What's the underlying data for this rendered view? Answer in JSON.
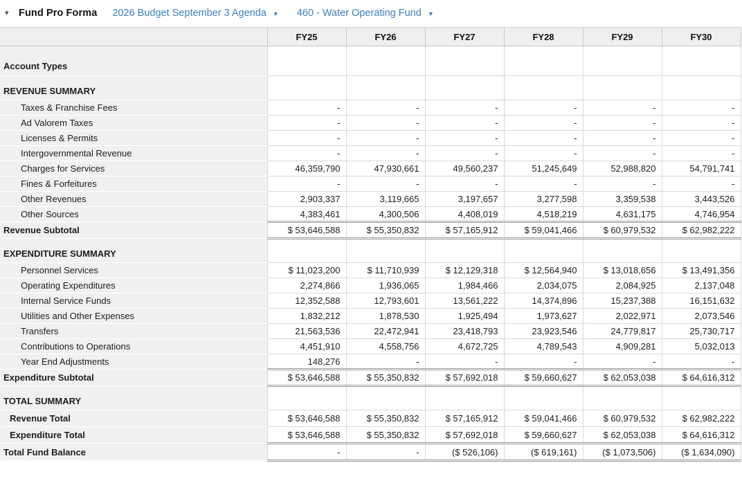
{
  "header": {
    "collapse_icon": "▾",
    "title": "Fund Pro Forma",
    "budget_dropdown": {
      "label": "2026 Budget September 3 Agenda",
      "caret": "▼"
    },
    "fund_dropdown": {
      "label": "460 - Water Operating Fund",
      "caret": "▼"
    }
  },
  "colors": {
    "link_blue": "#3f7fbf",
    "header_gray": "#efefef",
    "label_column_gray": "#f0f0f0",
    "grid_border": "#d9d9d9",
    "double_border": "#999999"
  },
  "table": {
    "columns": [
      "FY25",
      "FY26",
      "FY27",
      "FY28",
      "FY29",
      "FY30"
    ],
    "rows": [
      {
        "type": "account",
        "label": "Account Types",
        "values": [
          "",
          "",
          "",
          "",
          "",
          ""
        ]
      },
      {
        "type": "section",
        "label": "REVENUE SUMMARY",
        "values": [
          "",
          "",
          "",
          "",
          "",
          ""
        ]
      },
      {
        "type": "detail",
        "label": "Taxes & Franchise Fees",
        "values": [
          "-",
          "-",
          "-",
          "-",
          "-",
          "-"
        ]
      },
      {
        "type": "detail",
        "label": "Ad Valorem Taxes",
        "values": [
          "-",
          "-",
          "-",
          "-",
          "-",
          "-"
        ]
      },
      {
        "type": "detail",
        "label": "Licenses & Permits",
        "values": [
          "-",
          "-",
          "-",
          "-",
          "-",
          "-"
        ]
      },
      {
        "type": "detail",
        "label": "Intergovernmental Revenue",
        "values": [
          "-",
          "-",
          "-",
          "-",
          "-",
          "-"
        ]
      },
      {
        "type": "detail",
        "label": "Charges for Services",
        "values": [
          "46,359,790",
          "47,930,661",
          "49,560,237",
          "51,245,649",
          "52,988,820",
          "54,791,741"
        ]
      },
      {
        "type": "detail",
        "label": "Fines & Forfeitures",
        "values": [
          "-",
          "-",
          "-",
          "-",
          "-",
          "-"
        ]
      },
      {
        "type": "detail",
        "label": "Other Revenues",
        "values": [
          "2,903,337",
          "3,119,665",
          "3,197,657",
          "3,277,598",
          "3,359,538",
          "3,443,526"
        ]
      },
      {
        "type": "detail",
        "label": "Other Sources",
        "values": [
          "4,383,461",
          "4,300,506",
          "4,408,019",
          "4,518,219",
          "4,631,175",
          "4,746,954"
        ]
      },
      {
        "type": "subtotal",
        "label": "Revenue Subtotal",
        "values": [
          "$ 53,646,588",
          "$ 55,350,832",
          "$ 57,165,912",
          "$ 59,041,466",
          "$ 60,979,532",
          "$ 62,982,222"
        ]
      },
      {
        "type": "section",
        "label": "EXPENDITURE SUMMARY",
        "values": [
          "",
          "",
          "",
          "",
          "",
          ""
        ]
      },
      {
        "type": "detail",
        "label": "Personnel Services",
        "values": [
          "$ 11,023,200",
          "$ 11,710,939",
          "$ 12,129,318",
          "$ 12,564,940",
          "$ 13,018,656",
          "$ 13,491,356"
        ]
      },
      {
        "type": "detail",
        "label": "Operating Expenditures",
        "values": [
          "2,274,866",
          "1,936,065",
          "1,984,466",
          "2,034,075",
          "2,084,925",
          "2,137,048"
        ]
      },
      {
        "type": "detail",
        "label": "Internal Service Funds",
        "values": [
          "12,352,588",
          "12,793,601",
          "13,561,222",
          "14,374,896",
          "15,237,388",
          "16,151,632"
        ]
      },
      {
        "type": "detail",
        "label": "Utilities and Other Expenses",
        "values": [
          "1,832,212",
          "1,878,530",
          "1,925,494",
          "1,973,627",
          "2,022,971",
          "2,073,546"
        ]
      },
      {
        "type": "detail",
        "label": "Transfers",
        "values": [
          "21,563,536",
          "22,472,941",
          "23,418,793",
          "23,923,546",
          "24,779,817",
          "25,730,717"
        ]
      },
      {
        "type": "detail",
        "label": "Contributions to Operations",
        "values": [
          "4,451,910",
          "4,558,756",
          "4,672,725",
          "4,789,543",
          "4,909,281",
          "5,032,013"
        ]
      },
      {
        "type": "detail",
        "label": "Year End Adjustments",
        "values": [
          "148,276",
          "-",
          "-",
          "-",
          "-",
          "-"
        ]
      },
      {
        "type": "subtotal",
        "label": "Expenditure Subtotal",
        "values": [
          "$ 53,646,588",
          "$ 55,350,832",
          "$ 57,692,018",
          "$ 59,660,627",
          "$ 62,053,038",
          "$ 64,616,312"
        ]
      },
      {
        "type": "section",
        "label": "TOTAL SUMMARY",
        "values": [
          "",
          "",
          "",
          "",
          "",
          ""
        ]
      },
      {
        "type": "totalbold",
        "label": "Revenue Total",
        "values": [
          "$ 53,646,588",
          "$ 55,350,832",
          "$ 57,165,912",
          "$ 59,041,466",
          "$ 60,979,532",
          "$ 62,982,222"
        ]
      },
      {
        "type": "totalexp",
        "label": "Expenditure Total",
        "values": [
          "$ 53,646,588",
          "$ 55,350,832",
          "$ 57,692,018",
          "$ 59,660,627",
          "$ 62,053,038",
          "$ 64,616,312"
        ]
      },
      {
        "type": "balance",
        "label": "Total Fund Balance",
        "values": [
          "-",
          "-",
          "($ 526,106)",
          "($ 619,161)",
          "($ 1,073,506)",
          "($ 1,634,090)"
        ]
      }
    ]
  }
}
